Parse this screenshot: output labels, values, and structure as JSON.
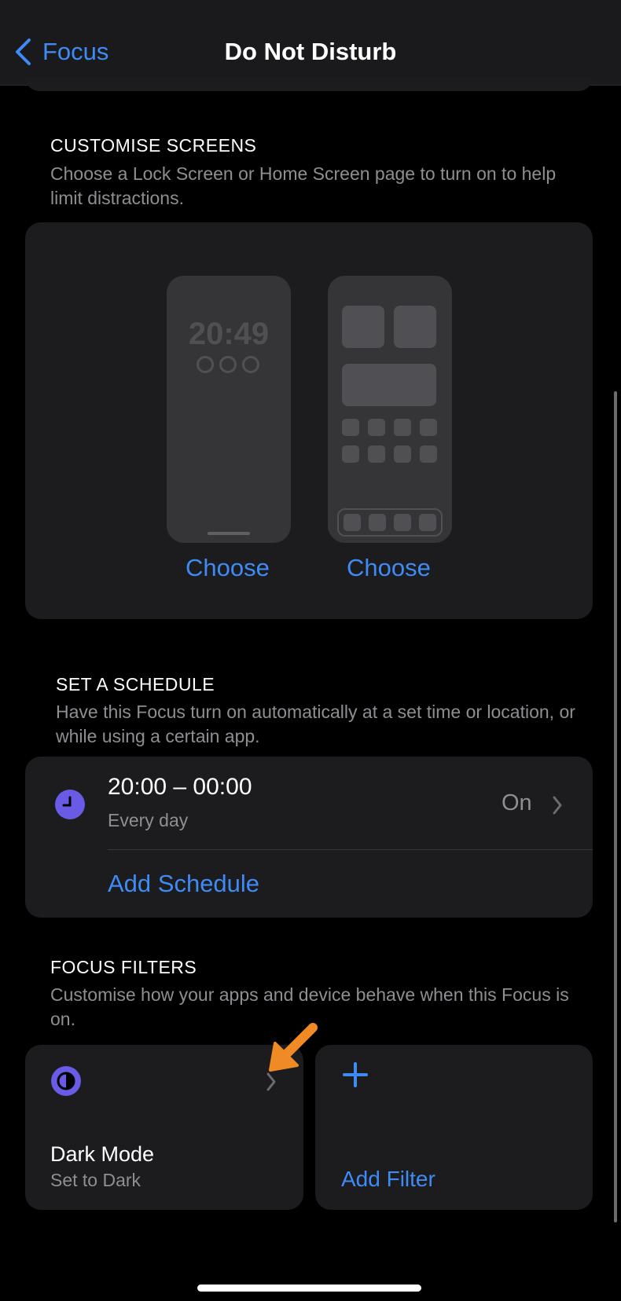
{
  "nav": {
    "back_label": "Focus",
    "title": "Do Not Disturb"
  },
  "customise": {
    "header": "CUSTOMISE SCREENS",
    "footer": "Choose a Lock Screen or Home Screen page to turn on to help limit distractions.",
    "lock_time": "20:49",
    "choose_lock_label": "Choose",
    "choose_home_label": "Choose"
  },
  "schedule": {
    "header": "SET A SCHEDULE",
    "footer": "Have this Focus turn on automatically at a set time or location, or while using a certain app.",
    "time_range": "20:00 – 00:00",
    "repeat": "Every day",
    "status": "On",
    "add_label": "Add Schedule"
  },
  "filters": {
    "header": "FOCUS FILTERS",
    "footer": "Customise how your apps and device behave when this Focus is on.",
    "dark_mode_title": "Dark Mode",
    "dark_mode_sub": "Set to Dark",
    "add_label": "Add Filter"
  },
  "colors": {
    "accent": "#3e8bf6",
    "icon_purple": "#6a5be6",
    "annotation_arrow": "#f08a24",
    "card_bg": "#1c1c1e"
  }
}
